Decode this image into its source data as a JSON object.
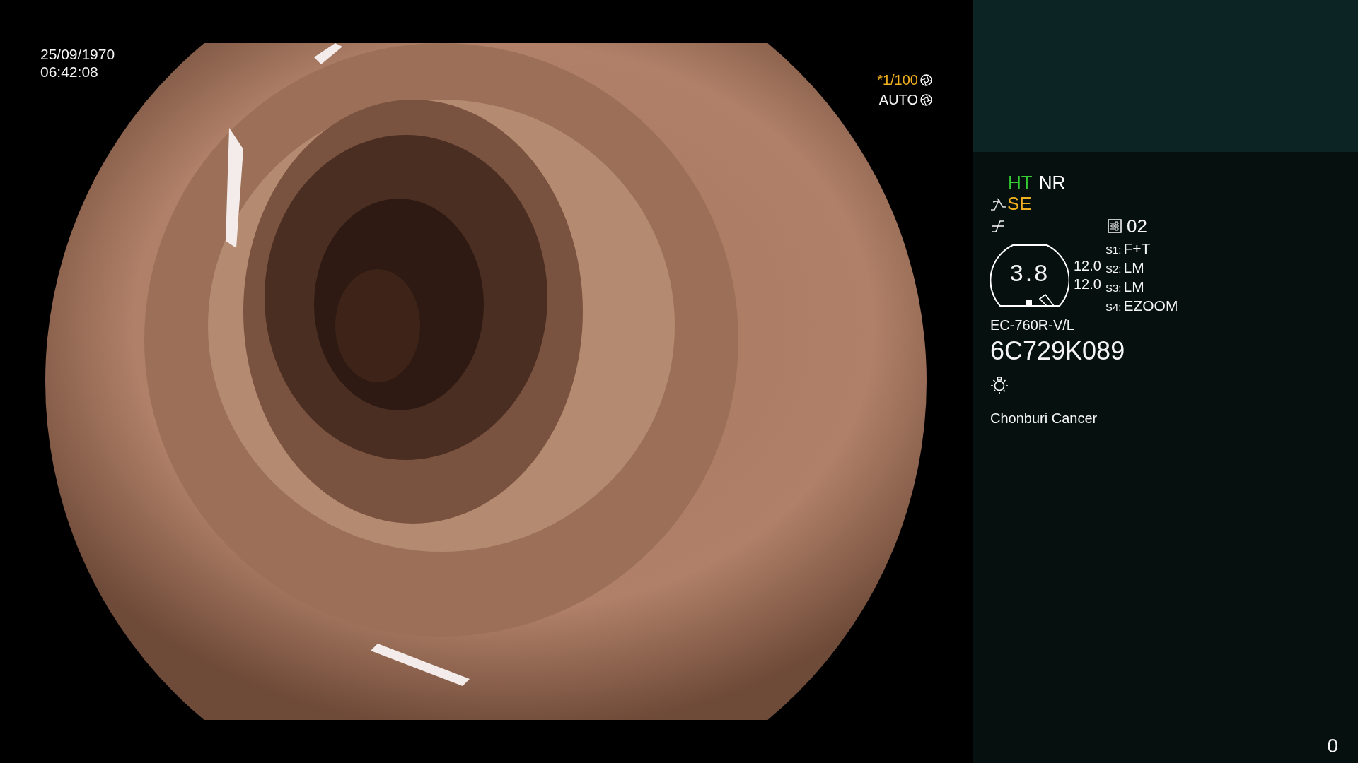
{
  "video": {
    "date": "25/09/1970",
    "time": "06:42:08",
    "shutter": "*1/100",
    "iris": "AUTO"
  },
  "panel": {
    "modes": [
      {
        "label": "HT",
        "color": "#33cc33"
      },
      {
        "label": "NR",
        "color": "#ffffff"
      }
    ],
    "enhance": "SE",
    "preset": "02",
    "gauge": {
      "value": "3.8",
      "readings": [
        "12.0",
        "12.0"
      ]
    },
    "switches": [
      {
        "label": "S1:",
        "value": "F+T"
      },
      {
        "label": "S2:",
        "value": "LM"
      },
      {
        "label": "S3:",
        "value": "LM"
      },
      {
        "label": "S4:",
        "value": "EZOOM"
      }
    ],
    "scope_model": "EC-760R-V/L",
    "serial": "6C729K089",
    "hospital": "Chonburi Cancer",
    "counter": "0"
  }
}
